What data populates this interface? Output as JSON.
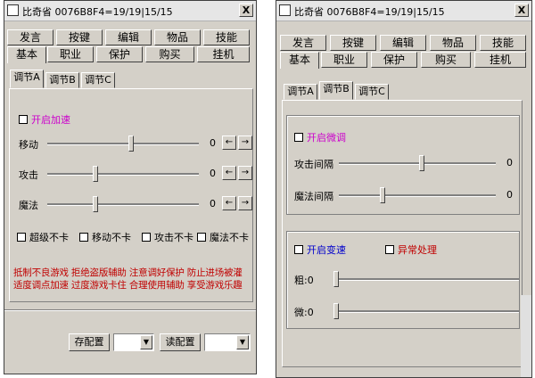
{
  "colors": {
    "face": "#d4d0c8",
    "magenta": "#cc00cc",
    "blue": "#0000cc",
    "red": "#c00000"
  },
  "left": {
    "title": "比奇省 0076B8F4=19/19|15/15",
    "close_label": "X",
    "tabs_row1": [
      "发言",
      "按键",
      "编辑",
      "物品",
      "技能"
    ],
    "tabs_row2": [
      "基本",
      "职业",
      "保护",
      "购买",
      "挂机"
    ],
    "subtabs": [
      "调节A",
      "调节B",
      "调节C"
    ],
    "accel_label": "开启加速",
    "sliders": [
      {
        "label": "移动",
        "value": "0",
        "level": 0.55
      },
      {
        "label": "攻击",
        "value": "0",
        "level": 0.32
      },
      {
        "label": "魔法",
        "value": "0",
        "level": 0.32
      }
    ],
    "arrow_left": "←",
    "arrow_right": "→",
    "checkboxes": [
      "超级不卡",
      "移动不卡",
      "攻击不卡",
      "魔法不卡"
    ],
    "warning_line1": "抵制不良游戏  拒绝盗版辅助  注意调好保护  防止进场被灌",
    "warning_line2": "适度调点加速  过度游戏卡住  合理使用辅助  享受游戏乐趣",
    "save_button": "存配置",
    "read_button": "读配置",
    "dropdown_arrow": "▼"
  },
  "right": {
    "title": "比奇省 0076B8F4=19/19|15/15",
    "close_label": "X",
    "tabs_row1": [
      "发言",
      "按键",
      "编辑",
      "物品",
      "技能"
    ],
    "tabs_row2": [
      "基本",
      "职业",
      "保护",
      "购买",
      "挂机"
    ],
    "subtabs": [
      "调节A",
      "调节B",
      "调节C"
    ],
    "fine_tune_label": "开启微调",
    "sliders": [
      {
        "label": "攻击间隔",
        "value": "0",
        "level": 0.53
      },
      {
        "label": "魔法间隔",
        "value": "0",
        "level": 0.28
      }
    ],
    "transform_label": "开启变速",
    "exception_label": "异常处理",
    "coarse_label": "粗:0",
    "fine_label": "微:0"
  }
}
